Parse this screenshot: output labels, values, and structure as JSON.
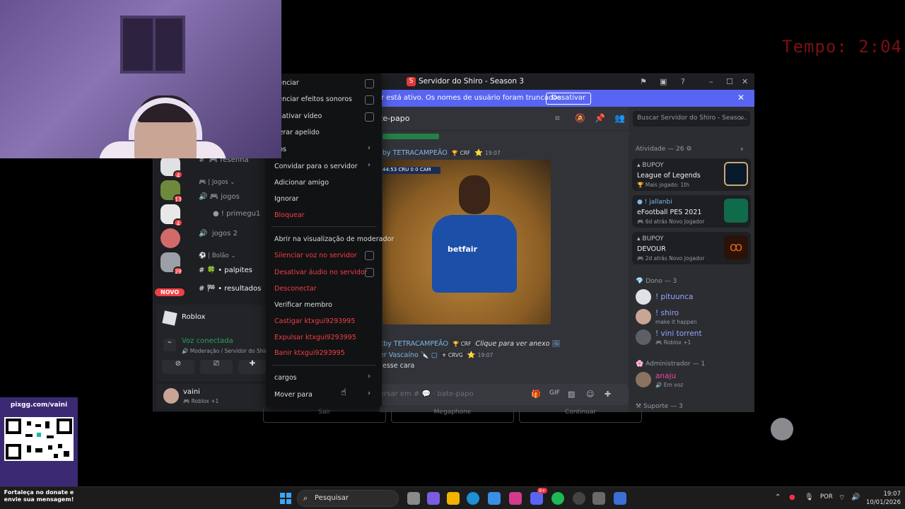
{
  "timer": "Tempo: 2:04",
  "window": {
    "logo": "S",
    "title": "Servidor do Shiro - Season 3",
    "controls": [
      "flag-icon",
      "inbox-icon",
      "help-icon",
      "minimize-icon",
      "maximize-icon",
      "close-icon"
    ]
  },
  "banner": {
    "text": "amer está ativo. Os nomes de usuário foram truncados.",
    "button": "Desativar"
  },
  "servers": {
    "badges": [
      "4",
      "13",
      "4",
      "29",
      "1"
    ],
    "novo": "NOVO"
  },
  "channels": {
    "resenha": "resenha",
    "cat_jogos": "| Jogos",
    "jogos": "jogos",
    "primegu": "! primegu1",
    "jogos2": "jogos 2",
    "cat_bolao": "| Bolão",
    "palpites": "palpites",
    "resultados": "resultados"
  },
  "activity_panel": {
    "game": "Roblox",
    "voice_status": "Voz conectada",
    "voice_channel": "Moderação / Servidor do Shir"
  },
  "user_panel": {
    "name": "vaini",
    "status": "Roblox +1"
  },
  "chat": {
    "channel": "te-papo",
    "author1": "by TETRACAMPEÃO",
    "tag1": "CRF",
    "time1": "19:07",
    "video_brand": "betfair",
    "video_score": "44:53 CRU 0 0 CAM",
    "reply_author": "cby TETRACAMPEÃO",
    "reply_tag": "CRF",
    "reply_text": "Clique para ver anexo",
    "author2": "er Vascaíno",
    "tag2": "CRVG",
    "time2": "19:07",
    "message2": "esse cara",
    "composer_placeholder": "ersar em #",
    "composer_channel": "bate-papo",
    "search_placeholder": "Buscar Servidor do Shiro - Seaso..."
  },
  "members": {
    "activity_header": "Atividade — 26",
    "activities": [
      {
        "user": "BUPOY",
        "game": "League of Legends",
        "sub": "Mais jogado: 1th",
        "color": "#0a1a2e"
      },
      {
        "user": "! jallanbi",
        "game": "eFootball PES 2021",
        "sub": "6d atrás   Novo Jogador",
        "color": "#0f6b4a"
      },
      {
        "user": "BUPOY",
        "game": "DEVOUR",
        "sub": "2d atrás   Novo Jogador",
        "color": "#2a1208"
      }
    ],
    "group_dono": "Dono — 3",
    "dono": [
      {
        "name": "! pituunca",
        "sub": "",
        "color": "#9aa5ff"
      },
      {
        "name": "! shiro",
        "sub": "make it happen",
        "color": "#9aa5ff"
      },
      {
        "name": "! vini torrent",
        "sub": "Roblox +1",
        "color": "#9aa5ff"
      }
    ],
    "group_admin": "Administrador — 1",
    "admin": [
      {
        "name": "anaju",
        "sub": "Em voz",
        "color": "#eb459e"
      }
    ],
    "group_suporte": "Suporte — 3"
  },
  "context_menu": {
    "items": [
      {
        "label": "ilenciar",
        "type": "check"
      },
      {
        "label": "ilenciar efeitos sonoros",
        "type": "check"
      },
      {
        "label": "esativar vídeo",
        "type": "check"
      },
      {
        "label": "Iterar apelido",
        "type": "plain"
      },
      {
        "label": "pps",
        "type": "arrow"
      },
      {
        "label": "Convidar para o servidor",
        "type": "arrow"
      },
      {
        "label": "Adicionar amigo",
        "type": "plain"
      },
      {
        "label": "Ignorar",
        "type": "plain"
      },
      {
        "label": "Bloquear",
        "type": "danger"
      },
      {
        "label": "Abrir na visualização de moderador",
        "type": "plain"
      },
      {
        "label": "Silenciar voz no servidor",
        "type": "danger-check"
      },
      {
        "label": "Desativar áudio no servidor",
        "type": "danger-check"
      },
      {
        "label": "Desconectar",
        "type": "danger"
      },
      {
        "label": "Verificar membro",
        "type": "plain"
      },
      {
        "label": "Castigar ktxgui9293995",
        "type": "danger"
      },
      {
        "label": "Expulsar ktxgui9293995",
        "type": "danger"
      },
      {
        "label": "Banir ktxgui9293995",
        "type": "danger"
      },
      {
        "label": "cargos",
        "type": "arrow"
      },
      {
        "label": "Mover para",
        "type": "arrow"
      }
    ]
  },
  "ghost_buttons": [
    "Sair",
    "Megaphone",
    "Continuar"
  ],
  "qr": {
    "url": "pixgg.com/vaini",
    "note": "Fortaleça no donate e envie sua mensagem!"
  },
  "taskbar": {
    "search": "Pesquisar",
    "lang": "POR",
    "time": "19:07",
    "date": "10/01/2026",
    "discord_badge": "9+"
  }
}
